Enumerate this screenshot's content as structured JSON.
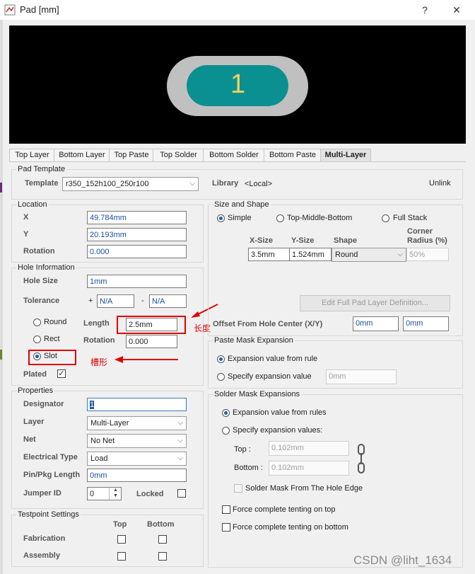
{
  "window": {
    "title": "Pad [mm]",
    "help": "?",
    "close": "✕"
  },
  "preview": {
    "pad_number": "1",
    "colors": {
      "outer": "#c0c0c0",
      "inner": "#0a9090",
      "number": "#f0d060",
      "background": "#000000"
    }
  },
  "tabs": [
    "Top Layer",
    "Bottom Layer",
    "Top Paste",
    "Top Solder",
    "Bottom Solder",
    "Bottom Paste",
    "Multi-Layer"
  ],
  "pad_template": {
    "title": "Pad Template",
    "template_label": "Template",
    "template_value": "r350_152h100_250r100",
    "library_label": "Library",
    "library_value": "<Local>",
    "unlink": "Unlink"
  },
  "location": {
    "title": "Location",
    "x_label": "X",
    "x_value": "49.784mm",
    "y_label": "Y",
    "y_value": "20.193mm",
    "rotation_label": "Rotation",
    "rotation_value": "0.000"
  },
  "hole": {
    "title": "Hole Information",
    "hole_size_label": "Hole Size",
    "hole_size_value": "1mm",
    "tolerance_label": "Tolerance",
    "plus": "+",
    "tol_plus": "N/A",
    "minus": "-",
    "tol_minus": "N/A",
    "round": "Round",
    "rect": "Rect",
    "slot": "Slot",
    "length_label": "Length",
    "length_value": "2.5mm",
    "rotation_label": "Rotation",
    "rotation_value": "0.000",
    "plated_label": "Plated",
    "plated_check": "✓"
  },
  "annotations": {
    "length": "长度",
    "slot": "槽形"
  },
  "properties": {
    "title": "Properties",
    "designator_label": "Designator",
    "designator_value": "1",
    "layer_label": "Layer",
    "layer_value": "Multi-Layer",
    "net_label": "Net",
    "net_value": "No Net",
    "etype_label": "Electrical Type",
    "etype_value": "Load",
    "pinpkg_label": "Pin/Pkg Length",
    "pinpkg_value": "0mm",
    "jumper_label": "Jumper ID",
    "jumper_value": "0",
    "locked_label": "Locked"
  },
  "testpoint": {
    "title": "Testpoint Settings",
    "top": "Top",
    "bottom": "Bottom",
    "fabrication": "Fabrication",
    "assembly": "Assembly"
  },
  "size_shape": {
    "title": "Size and Shape",
    "simple": "Simple",
    "tmb": "Top-Middle-Bottom",
    "full": "Full Stack",
    "xsize_h": "X-Size",
    "ysize_h": "Y-Size",
    "shape_h": "Shape",
    "corner_h1": "Corner",
    "corner_h2": "Radius (%)",
    "xsize": "3.5mm",
    "ysize": "1.524mm",
    "shape": "Round",
    "corner": "50%",
    "edit_btn": "Edit Full Pad Layer Definition...",
    "offset_label": "Offset From Hole Center (X/Y)",
    "offset_x": "0mm",
    "offset_y": "0mm"
  },
  "paste": {
    "title": "Paste Mask Expansion",
    "from_rule": "Expansion value from rule",
    "specify": "Specify expansion value",
    "value": "0mm"
  },
  "solder": {
    "title": "Solder Mask Expansions",
    "from_rules": "Expansion value from rules",
    "specify": "Specify expansion values:",
    "top_label": "Top :",
    "top_value": "0.102mm",
    "bottom_label": "Bottom :",
    "bottom_value": "0.102mm",
    "from_hole": "Solder Mask From The Hole Edge",
    "tent_top": "Force complete tenting on top",
    "tent_bottom": "Force complete tenting on bottom"
  },
  "watermark": "CSDN @liht_1634"
}
